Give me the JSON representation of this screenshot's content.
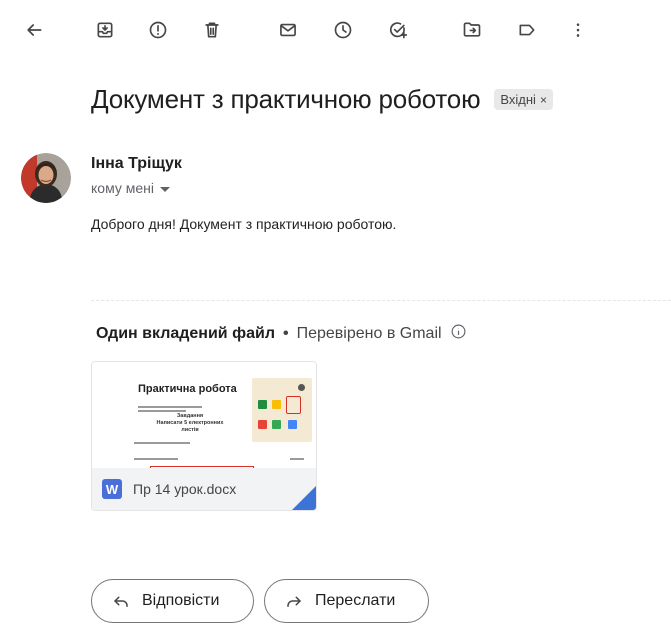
{
  "toolbar": {
    "buttons": [
      {
        "id": "back",
        "icon": "back-arrow-icon"
      },
      {
        "id": "archive",
        "icon": "archive-icon"
      },
      {
        "id": "report-spam",
        "icon": "report-spam-icon"
      },
      {
        "id": "delete",
        "icon": "trash-icon"
      },
      {
        "id": "mark-unread",
        "icon": "mail-icon"
      },
      {
        "id": "snooze",
        "icon": "clock-icon"
      },
      {
        "id": "add-task",
        "icon": "add-task-icon"
      },
      {
        "id": "move-to",
        "icon": "move-to-folder-icon"
      },
      {
        "id": "labels",
        "icon": "label-icon"
      },
      {
        "id": "more",
        "icon": "more-vert-icon"
      }
    ]
  },
  "email": {
    "subject": "Документ з практичною роботою",
    "label": "Вхідні",
    "label_close": "×",
    "sender_name": "Інна Тріщук",
    "recipient": "кому мені",
    "body": "Доброго дня! Документ з практичною роботою."
  },
  "attachments": {
    "count_label": "Один вкладений файл",
    "separator": "•",
    "verified": "Перевірено в Gmail",
    "file": {
      "name": "Пр 14 урок.docx",
      "type_letter": "W",
      "preview_title": "Практична робота",
      "preview_task": "Завдання\nНаписати 5 електронних листів"
    }
  },
  "actions": {
    "reply_label": "Відповісти",
    "forward_label": "Переслати"
  },
  "colors": {
    "word_blue": "#4a6fd8",
    "gmail_red": "#d93025",
    "text_primary": "#1f1f1f",
    "text_secondary": "#5f6368"
  }
}
